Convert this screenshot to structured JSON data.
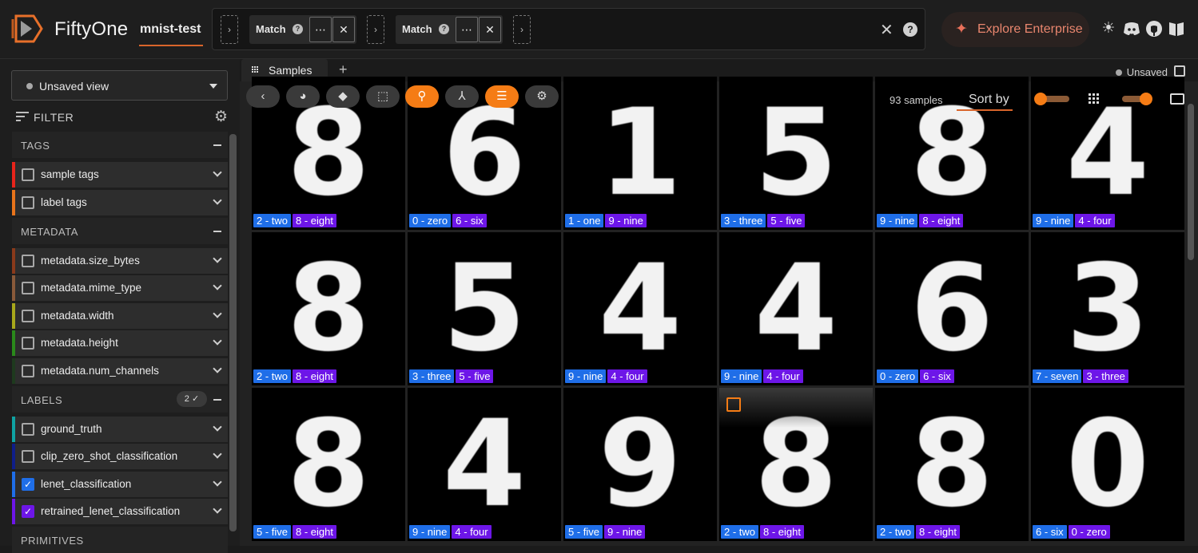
{
  "header": {
    "brand": "FiftyOne",
    "dataset": "mnist-test",
    "stages": [
      {
        "label": "Match",
        "help": "?",
        "more": "⋯",
        "remove": "✕"
      },
      {
        "label": "Match",
        "help": "?",
        "more": "⋯",
        "remove": "✕"
      }
    ],
    "add_stage": "›",
    "clear": "✕",
    "help": "?",
    "enterprise": "Explore Enterprise",
    "icons": [
      "sun-icon",
      "discord-icon",
      "github-icon",
      "book-icon"
    ]
  },
  "sidebar": {
    "view": "Unsaved view",
    "filter_label": "FILTER",
    "sections": [
      {
        "label": "TAGS",
        "fields": [
          {
            "label": "sample tags",
            "color": "#e8241b",
            "checked": false
          },
          {
            "label": "label tags",
            "color": "#e8741b",
            "checked": false
          }
        ]
      },
      {
        "label": "METADATA",
        "fields": [
          {
            "label": "metadata.size_bytes",
            "color": "#8a3a1b",
            "checked": false
          },
          {
            "label": "metadata.mime_type",
            "color": "#8a5a3a",
            "checked": false
          },
          {
            "label": "metadata.width",
            "color": "#a8a81b",
            "checked": false
          },
          {
            "label": "metadata.height",
            "color": "#2a8a1b",
            "checked": false
          },
          {
            "label": "metadata.num_channels",
            "color": "#1e3a1e",
            "checked": false
          }
        ]
      },
      {
        "label": "LABELS",
        "badge": "2 ✓",
        "fields": [
          {
            "label": "ground_truth",
            "color": "#0fa3a3",
            "checked": false
          },
          {
            "label": "clip_zero_shot_classification",
            "color": "#0f1e8a",
            "checked": false
          },
          {
            "label": "lenet_classification",
            "color": "#1f6ee8",
            "checked": true
          },
          {
            "label": "retrained_lenet_classification",
            "color": "#6d16e8",
            "checked": true
          }
        ]
      },
      {
        "label": "PRIMITIVES",
        "fields": []
      }
    ]
  },
  "main": {
    "tab": "Samples",
    "tab_add": "+",
    "status": "Unsaved",
    "count": "93 samples",
    "sort": "Sort by",
    "toolbar_icons": [
      "back-icon",
      "palette-icon",
      "tag-icon",
      "select-icon",
      "search-icon",
      "merge-icon",
      "list-icon",
      "settings-icon"
    ],
    "samples": [
      {
        "digit": "8",
        "gt": "2 - two",
        "pred": "8 - eight"
      },
      {
        "digit": "6",
        "gt": "0 - zero",
        "pred": "6 - six"
      },
      {
        "digit": "1",
        "gt": "1 - one",
        "pred": "9 - nine"
      },
      {
        "digit": "5",
        "gt": "3 - three",
        "pred": "5 - five"
      },
      {
        "digit": "8",
        "gt": "9 - nine",
        "pred": "8 - eight"
      },
      {
        "digit": "4",
        "gt": "9 - nine",
        "pred": "4 - four"
      },
      {
        "digit": "8",
        "gt": "2 - two",
        "pred": "8 - eight"
      },
      {
        "digit": "5",
        "gt": "3 - three",
        "pred": "5 - five"
      },
      {
        "digit": "4",
        "gt": "9 - nine",
        "pred": "4 - four"
      },
      {
        "digit": "4",
        "gt": "9 - nine",
        "pred": "4 - four"
      },
      {
        "digit": "6",
        "gt": "0 - zero",
        "pred": "6 - six"
      },
      {
        "digit": "3",
        "gt": "7 - seven",
        "pred": "3 - three"
      },
      {
        "digit": "8",
        "gt": "5 - five",
        "pred": "8 - eight"
      },
      {
        "digit": "4",
        "gt": "9 - nine",
        "pred": "4 - four"
      },
      {
        "digit": "9",
        "gt": "5 - five",
        "pred": "9 - nine"
      },
      {
        "digit": "8",
        "gt": "2 - two",
        "pred": "8 - eight"
      },
      {
        "digit": "8",
        "gt": "2 - two",
        "pred": "8 - eight"
      },
      {
        "digit": "0",
        "gt": "6 - six",
        "pred": "0 - zero"
      }
    ]
  }
}
